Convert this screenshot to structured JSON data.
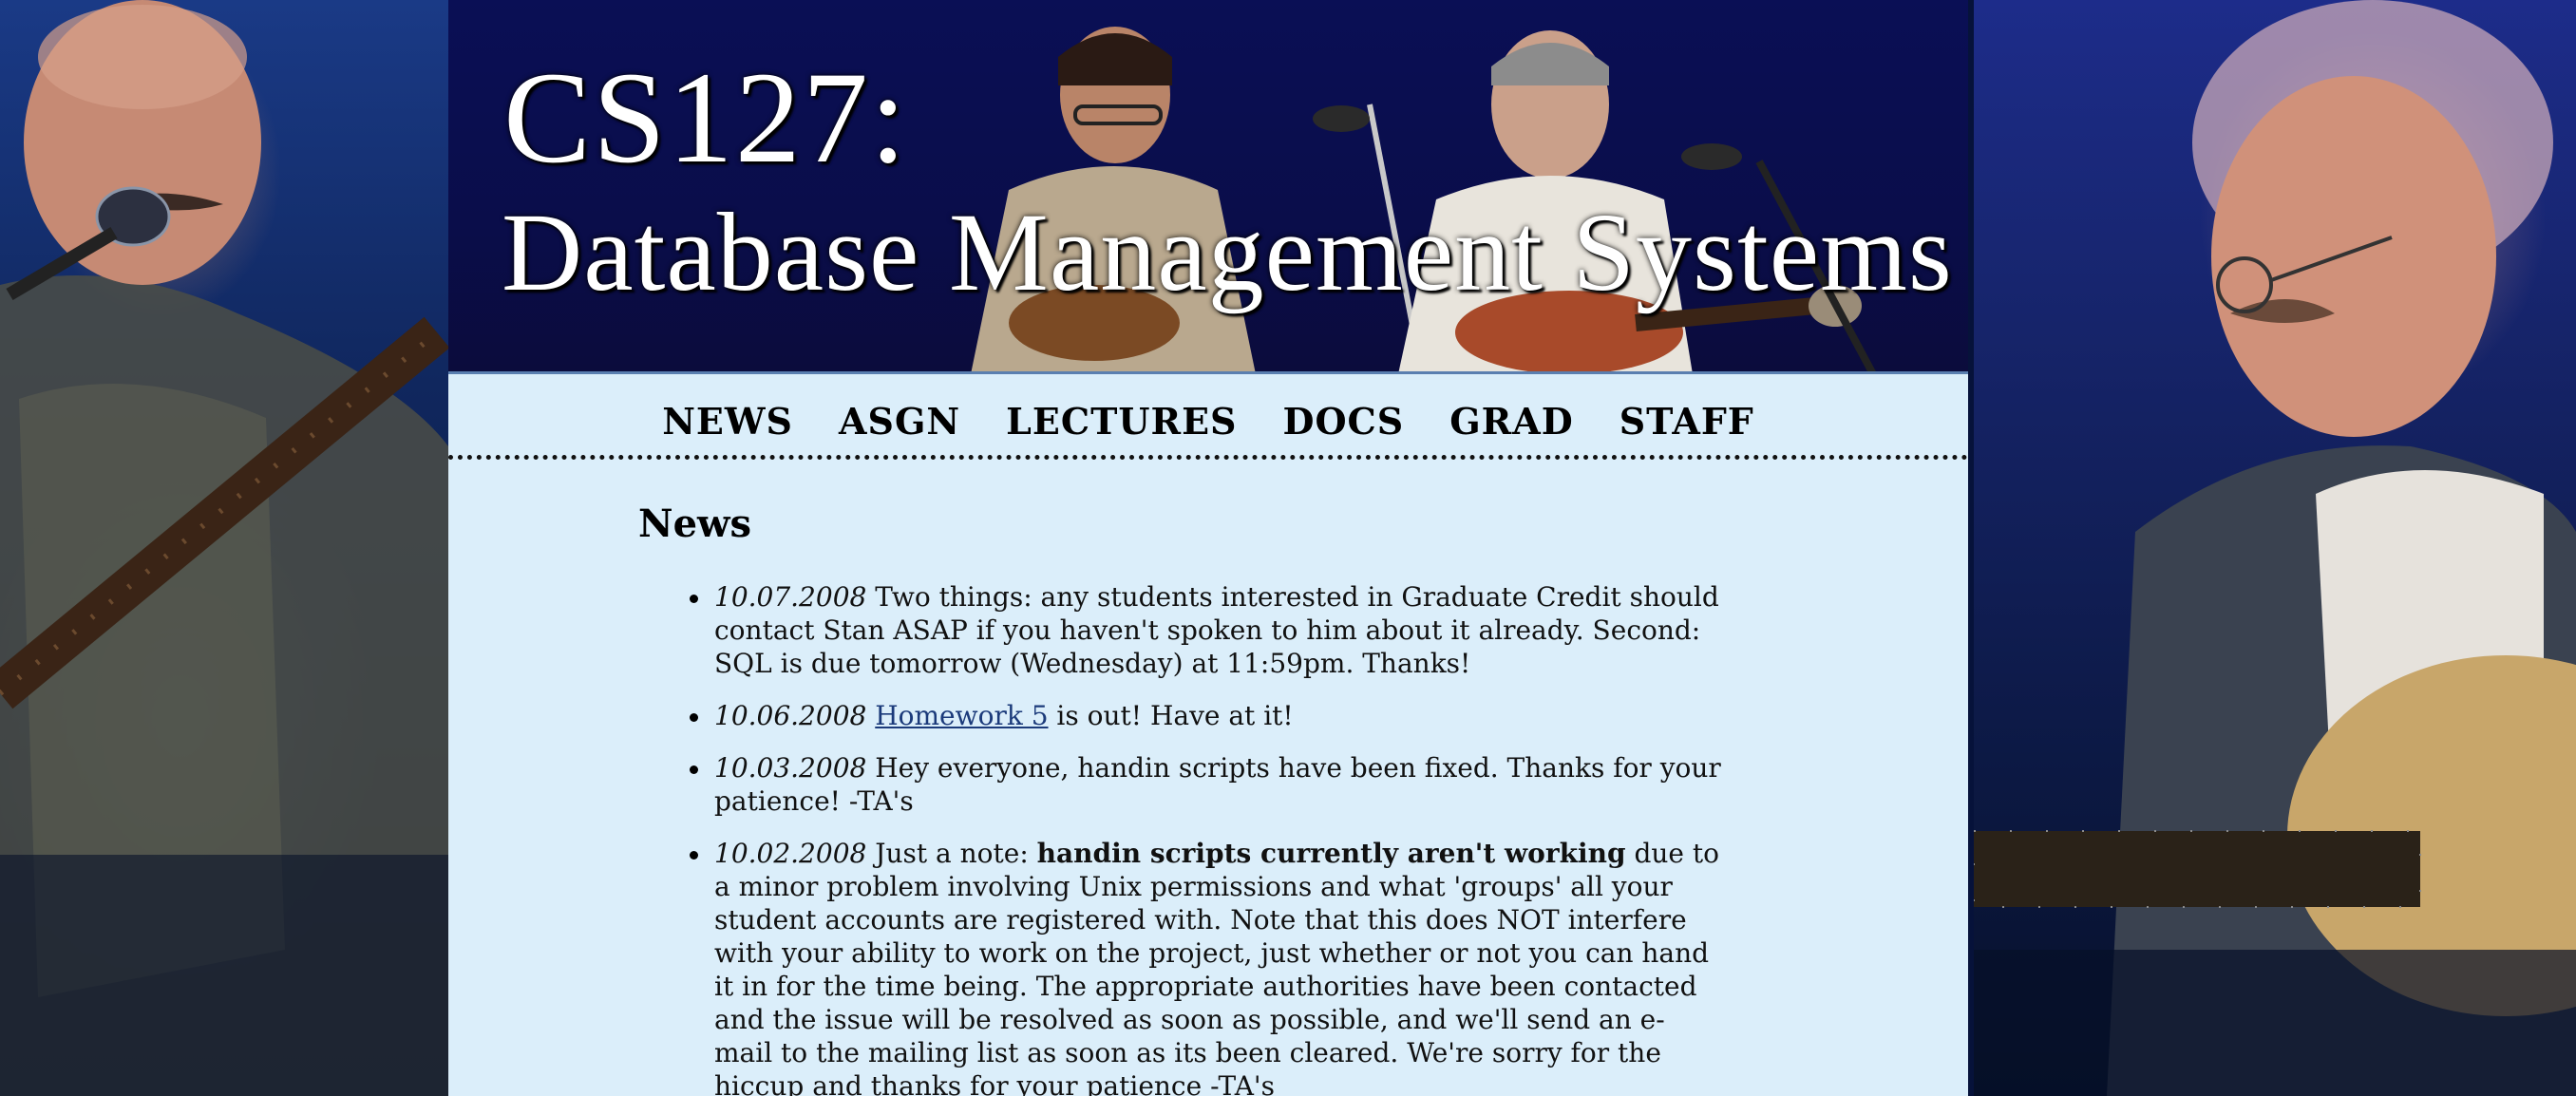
{
  "banner": {
    "title_line1": "CS127:",
    "title_line2": "Database Management Systems"
  },
  "nav": {
    "items": [
      "NEWS",
      "ASGN",
      "LECTURES",
      "DOCS",
      "GRAD",
      "STAFF"
    ]
  },
  "main": {
    "title": "News",
    "news": [
      {
        "date": "10.07.2008",
        "text": " Two things: any students interested in Graduate Credit should contact Stan ASAP if you haven't spoken to him about it already. Second: SQL is due tomorrow (Wednesday) at 11:59pm. Thanks!"
      },
      {
        "date": "10.06.2008",
        "pre": " ",
        "link": "Homework 5",
        "post": " is out! Have at it!"
      },
      {
        "date": "10.03.2008",
        "text": " Hey everyone, handin scripts have been fixed. Thanks for your patience! -TA's"
      },
      {
        "date": "10.02.2008",
        "pre": " Just a note: ",
        "strong": "handin scripts currently aren't working",
        "post": " due to a minor problem involving Unix permissions and what 'groups' all your student accounts are registered with. Note that this does NOT interfere with your ability to work on the project, just whether or not you can hand it in for the time being. The appropriate authorities have been contacted and the issue will be resolved as soon as possible, and we'll send an e-mail to the mailing list as soon as its been cleared. We're sorry for the hiccup and thanks for your patience -TA's"
      }
    ]
  },
  "colors": {
    "content_bg": "#dbeefa",
    "banner_bg": "#0a0f55",
    "link": "#1b3a7a",
    "side_bg": "#0d1a48"
  }
}
